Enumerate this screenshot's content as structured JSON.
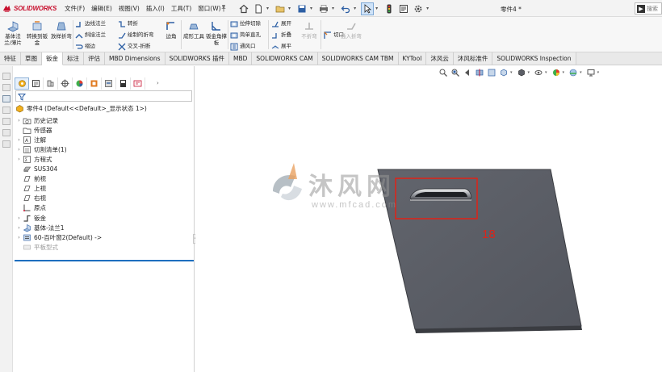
{
  "app": {
    "logo_text": "SOLIDWORKS",
    "document_title": "零件4 *",
    "brand_color": "#c8102e"
  },
  "menu": {
    "items": [
      "文件(F)",
      "编辑(E)",
      "视图(V)",
      "插入(I)",
      "工具(T)",
      "窗口(W)"
    ]
  },
  "search": {
    "placeholder": "搜索",
    "go_label": "▶"
  },
  "ribbon": {
    "big": [
      {
        "label": "基体法兰/薄片",
        "icon": "base-flange-icon"
      },
      {
        "label": "转换到钣金",
        "icon": "convert-to-sheetmetal-icon"
      },
      {
        "label": "放样折弯",
        "icon": "lofted-bend-icon"
      },
      {
        "label": "边角",
        "icon": "corners-icon"
      },
      {
        "label": "成形工具",
        "icon": "forming-tool-icon"
      },
      {
        "label": "钣金角撑板",
        "icon": "sheetmetal-gusset-icon"
      },
      {
        "label": "不折弯",
        "icon": "no-bends-icon"
      },
      {
        "label": "插入折弯",
        "icon": "insert-bends-icon"
      }
    ],
    "small": [
      {
        "label": "边线法兰",
        "icon": "edge-flange-icon"
      },
      {
        "label": "斜接法兰",
        "icon": "miter-flange-icon"
      },
      {
        "label": "褶边",
        "icon": "hem-icon"
      },
      {
        "label": "转折",
        "icon": "jog-icon"
      },
      {
        "label": "绘制的折弯",
        "icon": "sketched-bend-icon"
      },
      {
        "label": "交叉-折断",
        "icon": "cross-break-icon"
      },
      {
        "label": "拉伸切除",
        "icon": "extruded-cut-icon"
      },
      {
        "label": "简单直孔",
        "icon": "simple-hole-icon"
      },
      {
        "label": "通风口",
        "icon": "vent-icon"
      },
      {
        "label": "展开",
        "icon": "unfold-icon"
      },
      {
        "label": "折叠",
        "icon": "fold-icon"
      },
      {
        "label": "展平",
        "icon": "flatten-icon"
      },
      {
        "label": "切口",
        "icon": "rip-icon"
      }
    ]
  },
  "tabs": [
    "特征",
    "草图",
    "钣金",
    "标注",
    "评估",
    "MBD Dimensions",
    "SOLIDWORKS 插件",
    "MBD",
    "SOLIDWORKS CAM",
    "SOLIDWORKS CAM TBM",
    "KYTool",
    "沐风云",
    "沐风标准件",
    "SOLIDWORKS Inspection"
  ],
  "active_tab": "钣金",
  "feature_tree": {
    "root": "零件4  (Default<<Default>_显示状态 1>)",
    "items": [
      {
        "label": "历史记录",
        "expand": "›",
        "icon": "history-folder-icon"
      },
      {
        "label": "传感器",
        "expand": "",
        "icon": "sensors-icon"
      },
      {
        "label": "注解",
        "expand": "›",
        "icon": "annotations-icon"
      },
      {
        "label": "切割清单(1)",
        "expand": "›",
        "icon": "cut-list-icon"
      },
      {
        "label": "方程式",
        "expand": "›",
        "icon": "equations-icon"
      },
      {
        "label": "SUS304",
        "expand": "",
        "icon": "material-icon"
      },
      {
        "label": "前视",
        "expand": "",
        "icon": "plane-icon"
      },
      {
        "label": "上视",
        "expand": "",
        "icon": "plane-icon"
      },
      {
        "label": "右视",
        "expand": "",
        "icon": "plane-icon"
      },
      {
        "label": "原点",
        "expand": "",
        "icon": "origin-icon"
      },
      {
        "label": "钣金",
        "expand": "›",
        "icon": "sheet-metal-icon"
      },
      {
        "label": "基体-法兰1",
        "expand": "›",
        "icon": "base-flange-feature-icon"
      },
      {
        "label": "60-百叶窗2(Default) ->",
        "expand": "›",
        "icon": "louver-feature-icon"
      },
      {
        "label": "平板型式",
        "expand": "",
        "icon": "flat-pattern-icon",
        "dim": true
      }
    ]
  },
  "viewport": {
    "callout_number": "18",
    "callout_color": "#d9261c",
    "part_color": "#5b5e66",
    "watermark_title": "沐风网",
    "watermark_url": "www.mfcad.com"
  }
}
